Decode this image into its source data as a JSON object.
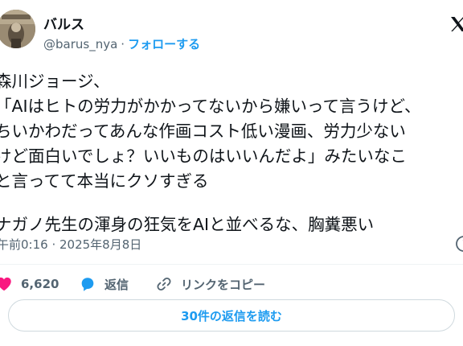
{
  "author": {
    "name": "バルス",
    "handle": "@barus_nya",
    "separator": "·",
    "follow_label": "フォローする"
  },
  "tweet": {
    "lines": [
      "森川ジョージ、",
      "「AIはヒトの労力がかかってないから嫌いって言うけど、",
      "ちいかわだってあんな作画コスト低い漫画、労力少ない",
      "けど面白いでしょ？いいものはいいんだよ」みたいなこ",
      "と言ってて本当にクソすぎる",
      "ナガノ先生の渾身の狂気をAIと並べるな、胸糞悪い"
    ],
    "timestamp": "午前0:16 · 2025年8月8日"
  },
  "actions": {
    "like_count": "6,620",
    "reply_label": "返信",
    "copy_link_label": "リンクをコピー"
  },
  "read_replies_label": "30件の返信を読む",
  "colors": {
    "accent": "#1d9bf0",
    "like": "#f91880",
    "secondary_text": "#536471"
  },
  "icons": [
    "avatar",
    "x-logo-icon",
    "info-icon",
    "heart-icon",
    "reply-icon",
    "link-icon"
  ]
}
